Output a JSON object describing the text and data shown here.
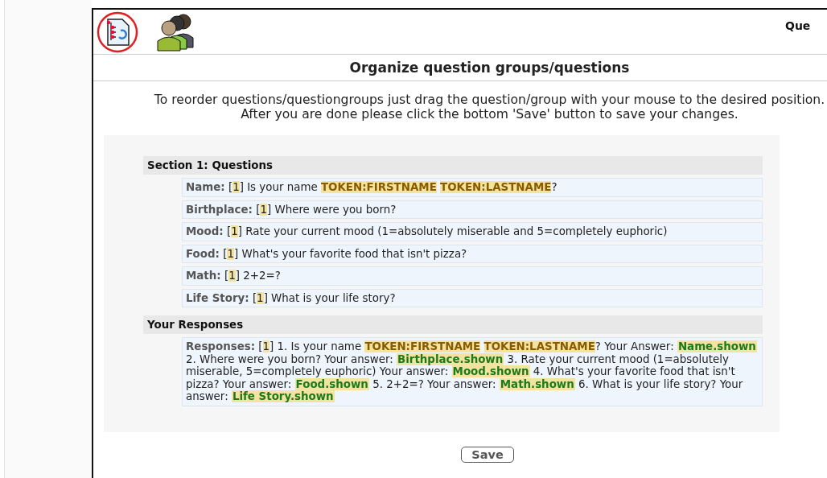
{
  "header": {
    "title": "Que"
  },
  "page_title": "Organize question groups/questions",
  "instructions": [
    "To reorder questions/questiongroups just drag the question/group with your mouse to the desired position.",
    "After you are done please click the bottom 'Save' button to save your changes."
  ],
  "groups": [
    {
      "title": "Section 1: Questions",
      "items": [
        {
          "parts": [
            {
              "kind": "label",
              "text": "Name:"
            },
            {
              "kind": "plain",
              "text": " ["
            },
            {
              "kind": "num",
              "text": "1"
            },
            {
              "kind": "plain",
              "text": "] Is your name "
            },
            {
              "kind": "token",
              "text": "TOKEN:FIRSTNAME"
            },
            {
              "kind": "token",
              "text": "TOKEN:LASTNAME"
            },
            {
              "kind": "plain",
              "text": "?"
            }
          ]
        },
        {
          "parts": [
            {
              "kind": "label",
              "text": "Birthplace:"
            },
            {
              "kind": "plain",
              "text": " ["
            },
            {
              "kind": "num",
              "text": "1"
            },
            {
              "kind": "plain",
              "text": "] Where were you born?"
            }
          ]
        },
        {
          "parts": [
            {
              "kind": "label",
              "text": "Mood:"
            },
            {
              "kind": "plain",
              "text": " ["
            },
            {
              "kind": "num",
              "text": "1"
            },
            {
              "kind": "plain",
              "text": "] Rate your current mood (1=absolutely miserable and 5=completely euphoric)"
            }
          ]
        },
        {
          "parts": [
            {
              "kind": "label",
              "text": "Food:"
            },
            {
              "kind": "plain",
              "text": " ["
            },
            {
              "kind": "num",
              "text": "1"
            },
            {
              "kind": "plain",
              "text": "] What's your favorite food that isn't pizza?"
            }
          ]
        },
        {
          "parts": [
            {
              "kind": "label",
              "text": "Math:"
            },
            {
              "kind": "plain",
              "text": " ["
            },
            {
              "kind": "num",
              "text": "1"
            },
            {
              "kind": "plain",
              "text": "] 2+2=?"
            }
          ]
        },
        {
          "parts": [
            {
              "kind": "label",
              "text": "Life Story:"
            },
            {
              "kind": "plain",
              "text": " ["
            },
            {
              "kind": "num",
              "text": "1"
            },
            {
              "kind": "plain",
              "text": "] What is your life story?"
            }
          ]
        }
      ]
    },
    {
      "title": "Your Responses",
      "items": [
        {
          "parts": [
            {
              "kind": "label",
              "text": "Responses:"
            },
            {
              "kind": "plain",
              "text": " ["
            },
            {
              "kind": "num",
              "text": "1"
            },
            {
              "kind": "plain",
              "text": "] 1. Is your name "
            },
            {
              "kind": "token",
              "text": "TOKEN:FIRSTNAME"
            },
            {
              "kind": "token",
              "text": "TOKEN:LASTNAME"
            },
            {
              "kind": "plain",
              "text": "? Your Answer: "
            },
            {
              "kind": "answer",
              "text": "Name.shown"
            },
            {
              "kind": "plain",
              "text": " 2. Where were you born? Your answer: "
            },
            {
              "kind": "answer",
              "text": "Birthplace.shown"
            },
            {
              "kind": "plain",
              "text": " 3. Rate your current mood (1=absolutely miserable, 5=completely euphoric) Your answer: "
            },
            {
              "kind": "answer",
              "text": "Mood.shown"
            },
            {
              "kind": "plain",
              "text": " 4. What's your favorite food that isn't pizza? Your answer: "
            },
            {
              "kind": "answer",
              "text": "Food.shown"
            },
            {
              "kind": "plain",
              "text": " 5. 2+2=? Your answer: "
            },
            {
              "kind": "answer",
              "text": "Math.shown"
            },
            {
              "kind": "plain",
              "text": " 6. What is your life story? Your answer: "
            },
            {
              "kind": "answer",
              "text": "Life Story.shown"
            }
          ]
        }
      ]
    }
  ],
  "save_button": "Save"
}
